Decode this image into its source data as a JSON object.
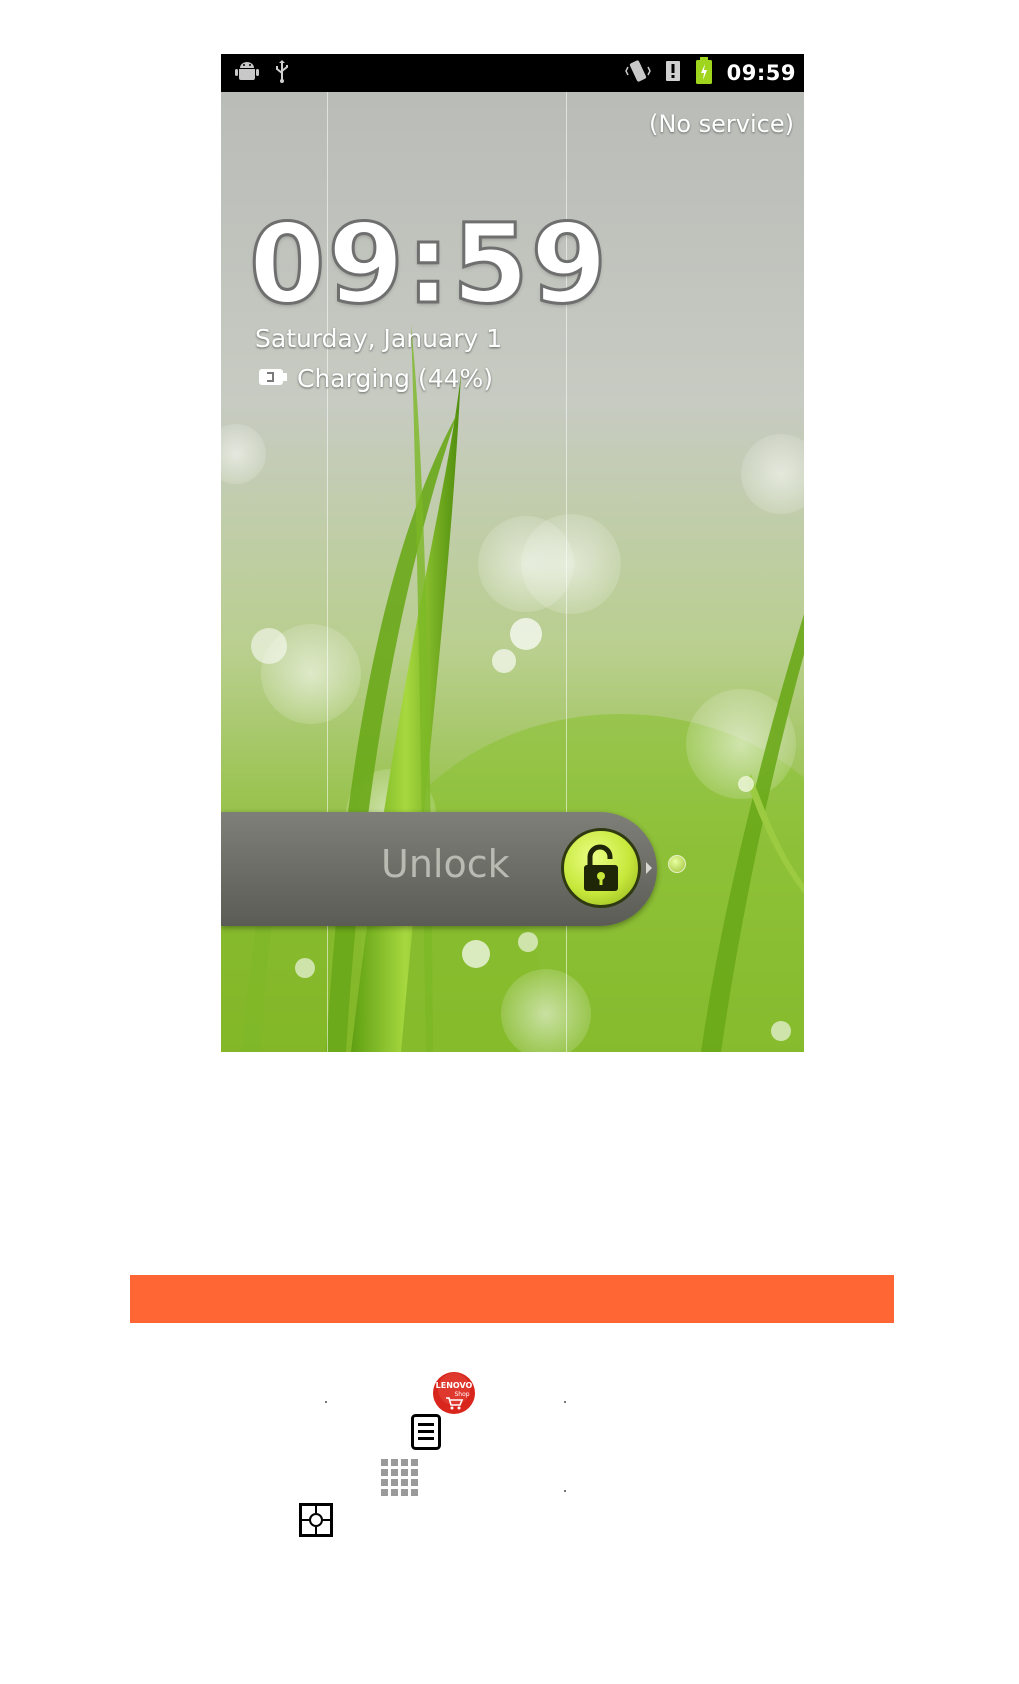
{
  "status_bar": {
    "time": "09:59",
    "left_icons": [
      "android-debug-icon",
      "usb-icon"
    ],
    "right_icons": [
      "vibrate-icon",
      "alert-icon",
      "battery-icon"
    ],
    "battery_color": "#9fd51c"
  },
  "lockscreen": {
    "carrier": "(No service)",
    "clock": "09:59",
    "date": "Saturday, January 1",
    "charging": "Charging (44%)",
    "unlock_label": "Unlock",
    "unlock_handle_icon": "unlock-padlock-icon",
    "handle_color": "#c7e83b"
  },
  "page": {
    "banner_color": "#ff6633",
    "inline_icons": [
      "lenovo-shop-icon",
      "menu-key-icon",
      "app-grid-icon",
      "camera-focus-icon"
    ],
    "shop_icon_text": [
      "LENOVO",
      "Shop"
    ]
  }
}
